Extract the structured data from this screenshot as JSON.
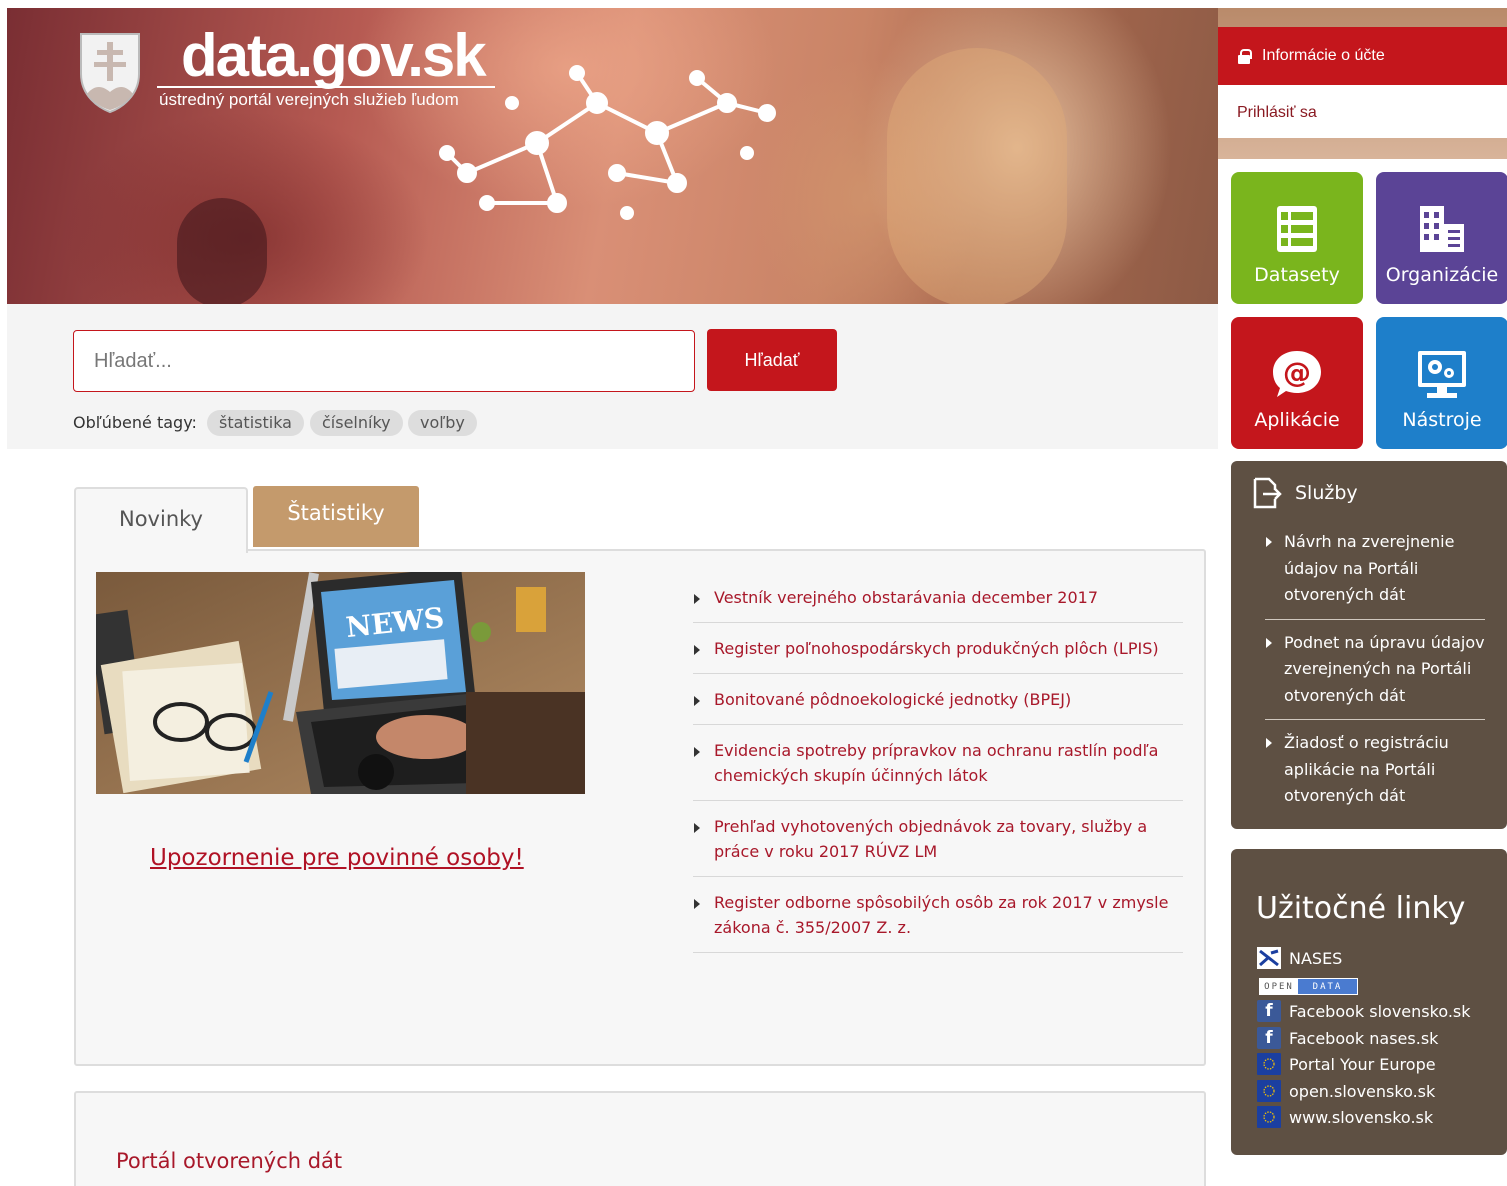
{
  "branding": {
    "logo_text": "data.gov.sk",
    "logo_subtitle": "ústredný portál verejných služieb ľudom"
  },
  "account": {
    "header": "Informácie o účte",
    "login": "Prihlásiť sa"
  },
  "tiles": [
    {
      "label": "Datasety",
      "icon": "dataset-icon",
      "color": "#7ab51d"
    },
    {
      "label": "Organizácie",
      "icon": "building-icon",
      "color": "#5b4496"
    },
    {
      "label": "Aplikácie",
      "icon": "at-sign-icon",
      "color": "#c4161c"
    },
    {
      "label": "Nástroje",
      "icon": "monitor-gears-icon",
      "color": "#1e7fca"
    }
  ],
  "search": {
    "placeholder": "Hľadať...",
    "button": "Hľadať"
  },
  "tags": {
    "label": "Obľúbené tagy:",
    "items": [
      "štatistika",
      "číselníky",
      "voľby"
    ]
  },
  "tabs": {
    "novinky": "Novinky",
    "statistiky": "Štatistiky"
  },
  "news": {
    "image_text": "NEWS",
    "warning_link": "Upozornenie pre povinné osoby!",
    "items": [
      "Vestník verejného obstarávania december 2017",
      "Register poľnohospodárskych produkčných plôch (LPIS)",
      "Bonitované pôdnoekologické jednotky (BPEJ)",
      "Evidencia spotreby prípravkov na ochranu rastlín podľa chemických skupín účinných látok",
      "Prehľad vyhotovených objednávok za tovary, služby a práce v roku 2017 RÚVZ LM",
      "Register odborne spôsobilých osôb za rok 2017 v zmysle zákona č. 355/2007 Z. z."
    ]
  },
  "portal": {
    "title": "Portál otvorených dát"
  },
  "sluzby": {
    "title": "Služby",
    "items": [
      "Návrh na zverejnenie údajov na Portáli otvorených dát",
      "Podnet na úpravu údajov zverejnených na Portáli otvorených dát",
      "Žiadosť o registráciu aplikácie na Portáli otvorených dát"
    ]
  },
  "links": {
    "title": "Užitočné linky",
    "opendata_left": "OPEN",
    "opendata_right": "DATA",
    "items": [
      {
        "label": "NASES",
        "icon": "nases-icon"
      },
      {
        "label": "Facebook slovensko.sk",
        "icon": "facebook-icon"
      },
      {
        "label": "Facebook nases.sk",
        "icon": "facebook-icon"
      },
      {
        "label": "Portal Your Europe",
        "icon": "eu-flag-icon"
      },
      {
        "label": "open.slovensko.sk",
        "icon": "eu-flag-icon"
      },
      {
        "label": "www.slovensko.sk",
        "icon": "eu-flag-icon"
      }
    ]
  },
  "colors": {
    "accent_red": "#c4161c",
    "link_red": "#a8182a",
    "sidebar_brown": "#5e5043",
    "tab_tan": "#c49a6c"
  }
}
